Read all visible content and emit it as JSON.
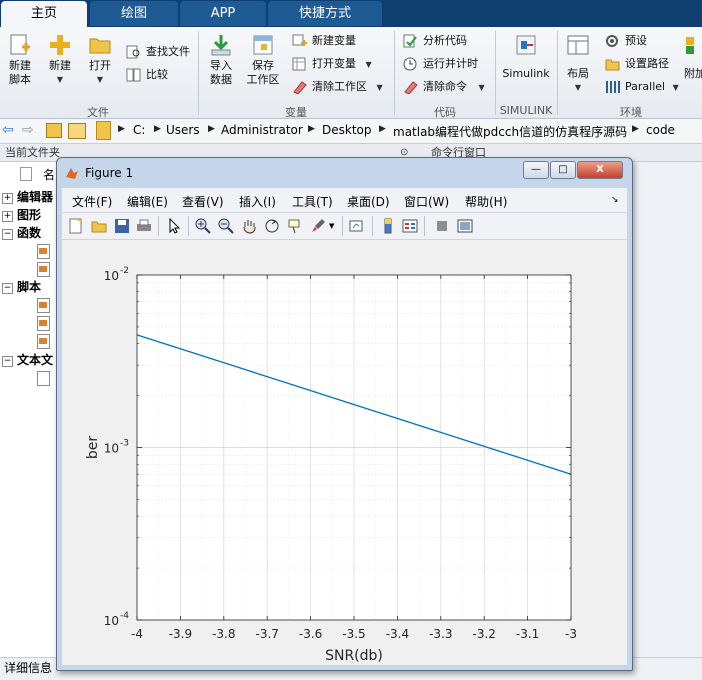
{
  "tabs": [
    {
      "label": "主页",
      "active": true
    },
    {
      "label": "绘图",
      "active": false
    },
    {
      "label": "APP",
      "active": false
    },
    {
      "label": "快捷方式",
      "active": false
    }
  ],
  "ribbon": {
    "new_script": "新建\n脚本",
    "new": "新建",
    "open": "打开",
    "find_files": "查找文件",
    "compare": "比较",
    "import_data": "导入\n数据",
    "save_workspace": "保存\n工作区",
    "new_variable": "新建变量",
    "open_variable": "打开变量",
    "clear_workspace": "清除工作区",
    "analyze_code": "分析代码",
    "run_and_time": "运行并计时",
    "clear_commands": "清除命令",
    "simulink": "Simulink",
    "layout": "布局",
    "preferences": "预设",
    "set_path": "设置路径",
    "parallel": "Parallel",
    "addons": "附加",
    "groups": {
      "file": "文件",
      "variable": "变量",
      "code": "代码",
      "simulink": "SIMULINK",
      "environment": "环境"
    }
  },
  "address": {
    "crumbs": [
      "C:",
      "Users",
      "Administrator",
      "Desktop",
      "matlab编程代做pdcch信道的仿真程序源码",
      "code"
    ]
  },
  "panels": {
    "current_folder": "当前文件夹",
    "command_window": "命令行窗口",
    "name_col": "名",
    "tree": {
      "editor": "编辑器",
      "figures": "图形",
      "functions": "函数",
      "scripts": "脚本",
      "text_files": "文本文"
    },
    "details": "详细信息"
  },
  "figure": {
    "title": "Figure 1",
    "menus": [
      "文件(F)",
      "编辑(E)",
      "查看(V)",
      "插入(I)",
      "工具(T)",
      "桌面(D)",
      "窗口(W)",
      "帮助(H)"
    ],
    "window_buttons": {
      "minimize": "—",
      "maximize": "□",
      "close": "X"
    }
  },
  "chart_data": {
    "type": "line",
    "title": "",
    "xlabel": "SNR(db)",
    "ylabel": "ber",
    "xlim": [
      -4,
      -3
    ],
    "ylim": [
      0.0001,
      0.01
    ],
    "yscale": "log",
    "grid": true,
    "minor_grid": true,
    "x_ticks": [
      "-4",
      "-3.9",
      "-3.8",
      "-3.7",
      "-3.6",
      "-3.5",
      "-3.4",
      "-3.3",
      "-3.2",
      "-3.1",
      "-3"
    ],
    "y_ticks": [
      {
        "base": "10",
        "exp": "-2"
      },
      {
        "base": "10",
        "exp": "-3"
      },
      {
        "base": "10",
        "exp": "-4"
      }
    ],
    "series": [
      {
        "color": "#0072bd",
        "x": [
          -4,
          -3
        ],
        "y": [
          0.0045,
          0.0007
        ]
      }
    ]
  }
}
